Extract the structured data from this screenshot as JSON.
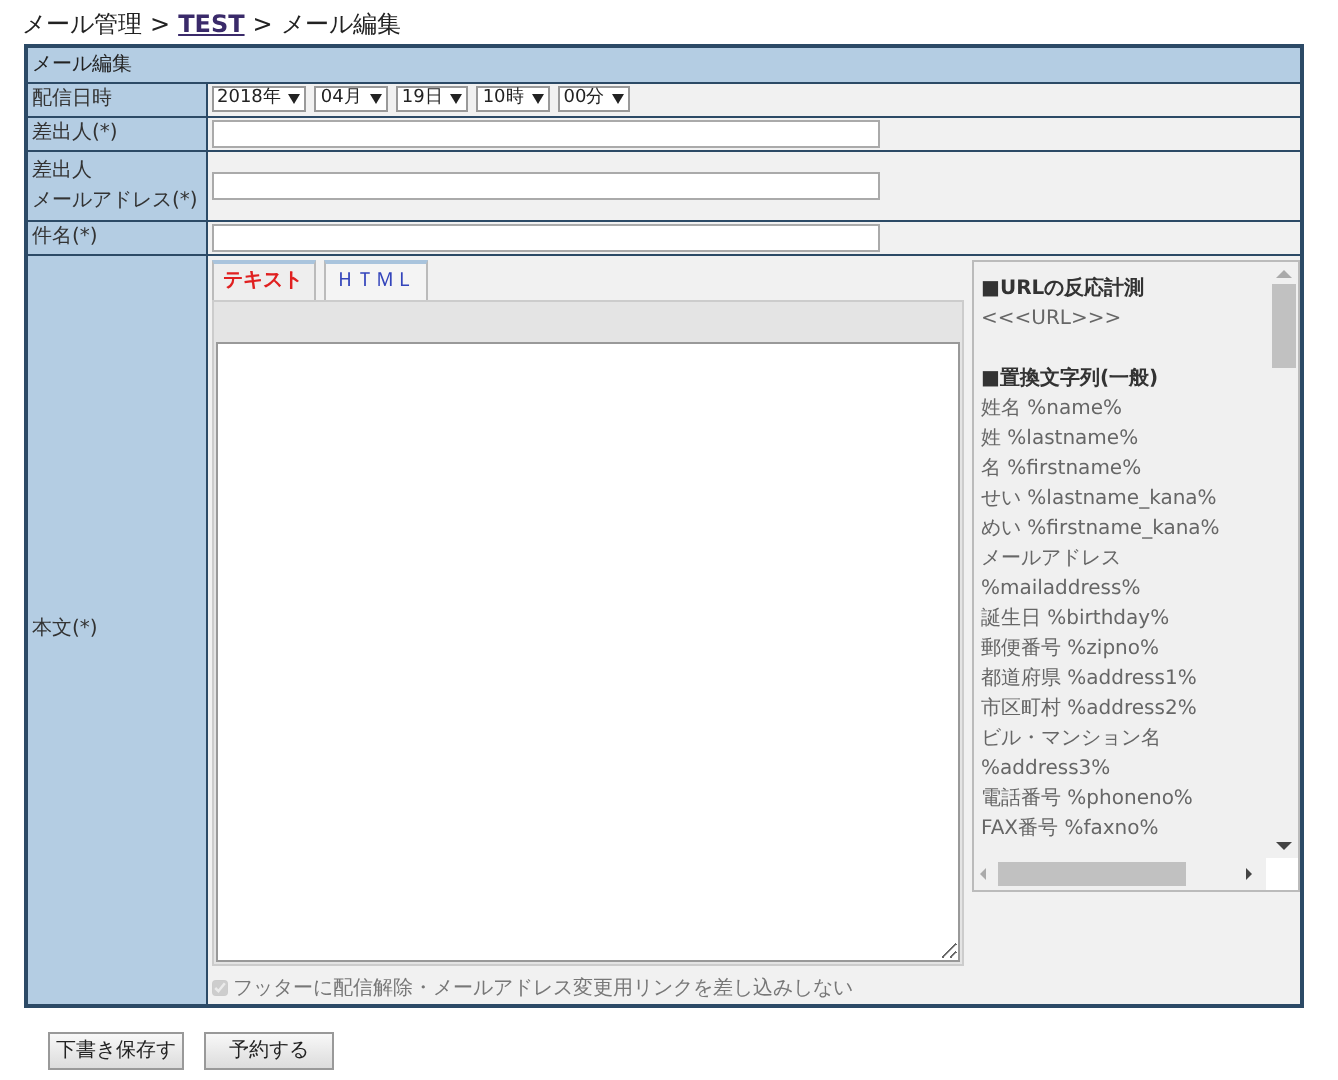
{
  "breadcrumb": [
    {
      "label": "メール管理",
      "kind": "text"
    },
    {
      "label": ">",
      "kind": "separator"
    },
    {
      "label": "TEST",
      "kind": "link"
    },
    {
      "label": ">",
      "kind": "separator"
    },
    {
      "label": "メール編集",
      "kind": "text"
    }
  ],
  "form": {
    "title": "メール編集",
    "date_row": {
      "label": "配信日時",
      "selects": [
        "2018年",
        "04月",
        "19日",
        "10時",
        "00分"
      ]
    },
    "fields": [
      {
        "label": "差出人(*)"
      },
      {
        "label": "差出人",
        "label_line_2": "メールアドレス(*)"
      },
      {
        "label": "件名(*)"
      }
    ],
    "body": {
      "label": "本文(*)",
      "tabs": [
        {
          "label": "テキスト",
          "selected": true
        },
        {
          "label": "ＨＴＭＬ",
          "selected": false
        }
      ],
      "footer_option": {
        "label": "フッターに配信解除・メールアドレス変更用リンクを差し込みしない",
        "checked": true,
        "disabled": true
      },
      "variables": [
        {
          "kind": "heading",
          "text": "■URLの反応計測"
        },
        {
          "kind": "item",
          "text": "<<<URL>>>"
        },
        {
          "kind": "spacer"
        },
        {
          "kind": "heading",
          "text": "■置換文字列(一般)"
        },
        {
          "kind": "item",
          "text": "姓名 %name%"
        },
        {
          "kind": "item",
          "text": "姓 %lastname%"
        },
        {
          "kind": "item",
          "text": "名 %firstname%"
        },
        {
          "kind": "item",
          "text": "せい %lastname_kana%"
        },
        {
          "kind": "item",
          "text": "めい %firstname_kana%"
        },
        {
          "kind": "item",
          "text": "メールアドレス"
        },
        {
          "kind": "item",
          "text": "%mailaddress%"
        },
        {
          "kind": "item",
          "text": "誕生日 %birthday%"
        },
        {
          "kind": "item",
          "text": "郵便番号 %zipno%"
        },
        {
          "kind": "item",
          "text": "都道府県 %address1%"
        },
        {
          "kind": "item",
          "text": "市区町村 %address2%"
        },
        {
          "kind": "item",
          "text": "ビル・マンション名"
        },
        {
          "kind": "item",
          "text": "%address3%"
        },
        {
          "kind": "item",
          "text": "電話番号 %phoneno%"
        },
        {
          "kind": "item",
          "text": "FAX番号 %faxno%"
        }
      ]
    }
  },
  "buttons": [
    "下書き保存す",
    "予約する"
  ]
}
